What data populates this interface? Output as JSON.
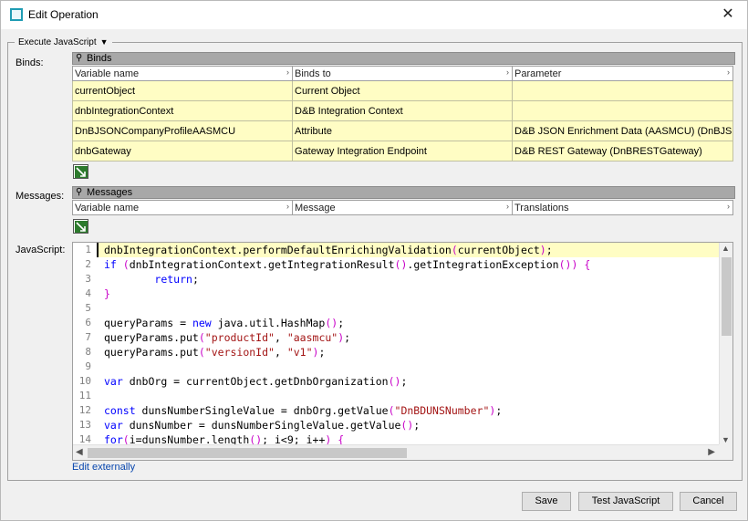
{
  "window": {
    "title": "Edit Operation"
  },
  "group": {
    "label": "Execute JavaScript"
  },
  "binds": {
    "label": "Binds:",
    "header": "Binds",
    "columns": [
      "Variable name",
      "Binds to",
      "Parameter"
    ],
    "rows": [
      [
        "currentObject",
        "Current Object",
        ""
      ],
      [
        "dnbIntegrationContext",
        "D&B Integration Context",
        ""
      ],
      [
        "DnBJSONCompanyProfileAASMCU",
        "Attribute",
        "D&B JSON Enrichment Data (AASMCU) (DnBJS..."
      ],
      [
        "dnbGateway",
        "Gateway Integration Endpoint",
        "D&B REST Gateway (DnBRESTGateway)"
      ]
    ]
  },
  "messages": {
    "label": "Messages:",
    "header": "Messages",
    "columns": [
      "Variable name",
      "Message",
      "Translations"
    ]
  },
  "javascript": {
    "label": "JavaScript:",
    "line_numbers": [
      "1",
      "2",
      "3",
      "4",
      "5",
      "6",
      "7",
      "8",
      "9",
      "10",
      "11",
      "12",
      "13",
      "14"
    ],
    "lines": [
      "dnbIntegrationContext.performDefaultEnrichingValidation(currentObject);",
      "if (dnbIntegrationContext.getIntegrationResult().getIntegrationException()) {",
      "        return;",
      "}",
      "",
      "queryParams = new java.util.HashMap();",
      "queryParams.put(\"productId\", \"aasmcu\");",
      "queryParams.put(\"versionId\", \"v1\");",
      "",
      "var dnbOrg = currentObject.getDnbOrganization();",
      "",
      "const dunsNumberSingleValue = dnbOrg.getValue(\"DnBDUNSNumber\");",
      "var dunsNumber = dunsNumberSingleValue.getValue();",
      "for(i=dunsNumber.length(); i<9; i++) {"
    ]
  },
  "edit_externally": "Edit externally",
  "buttons": {
    "save": "Save",
    "test": "Test JavaScript",
    "cancel": "Cancel"
  },
  "colors": {
    "row_highlight": "#fffdc4",
    "header_gray": "#a8a8a8",
    "link": "#0645ad"
  }
}
